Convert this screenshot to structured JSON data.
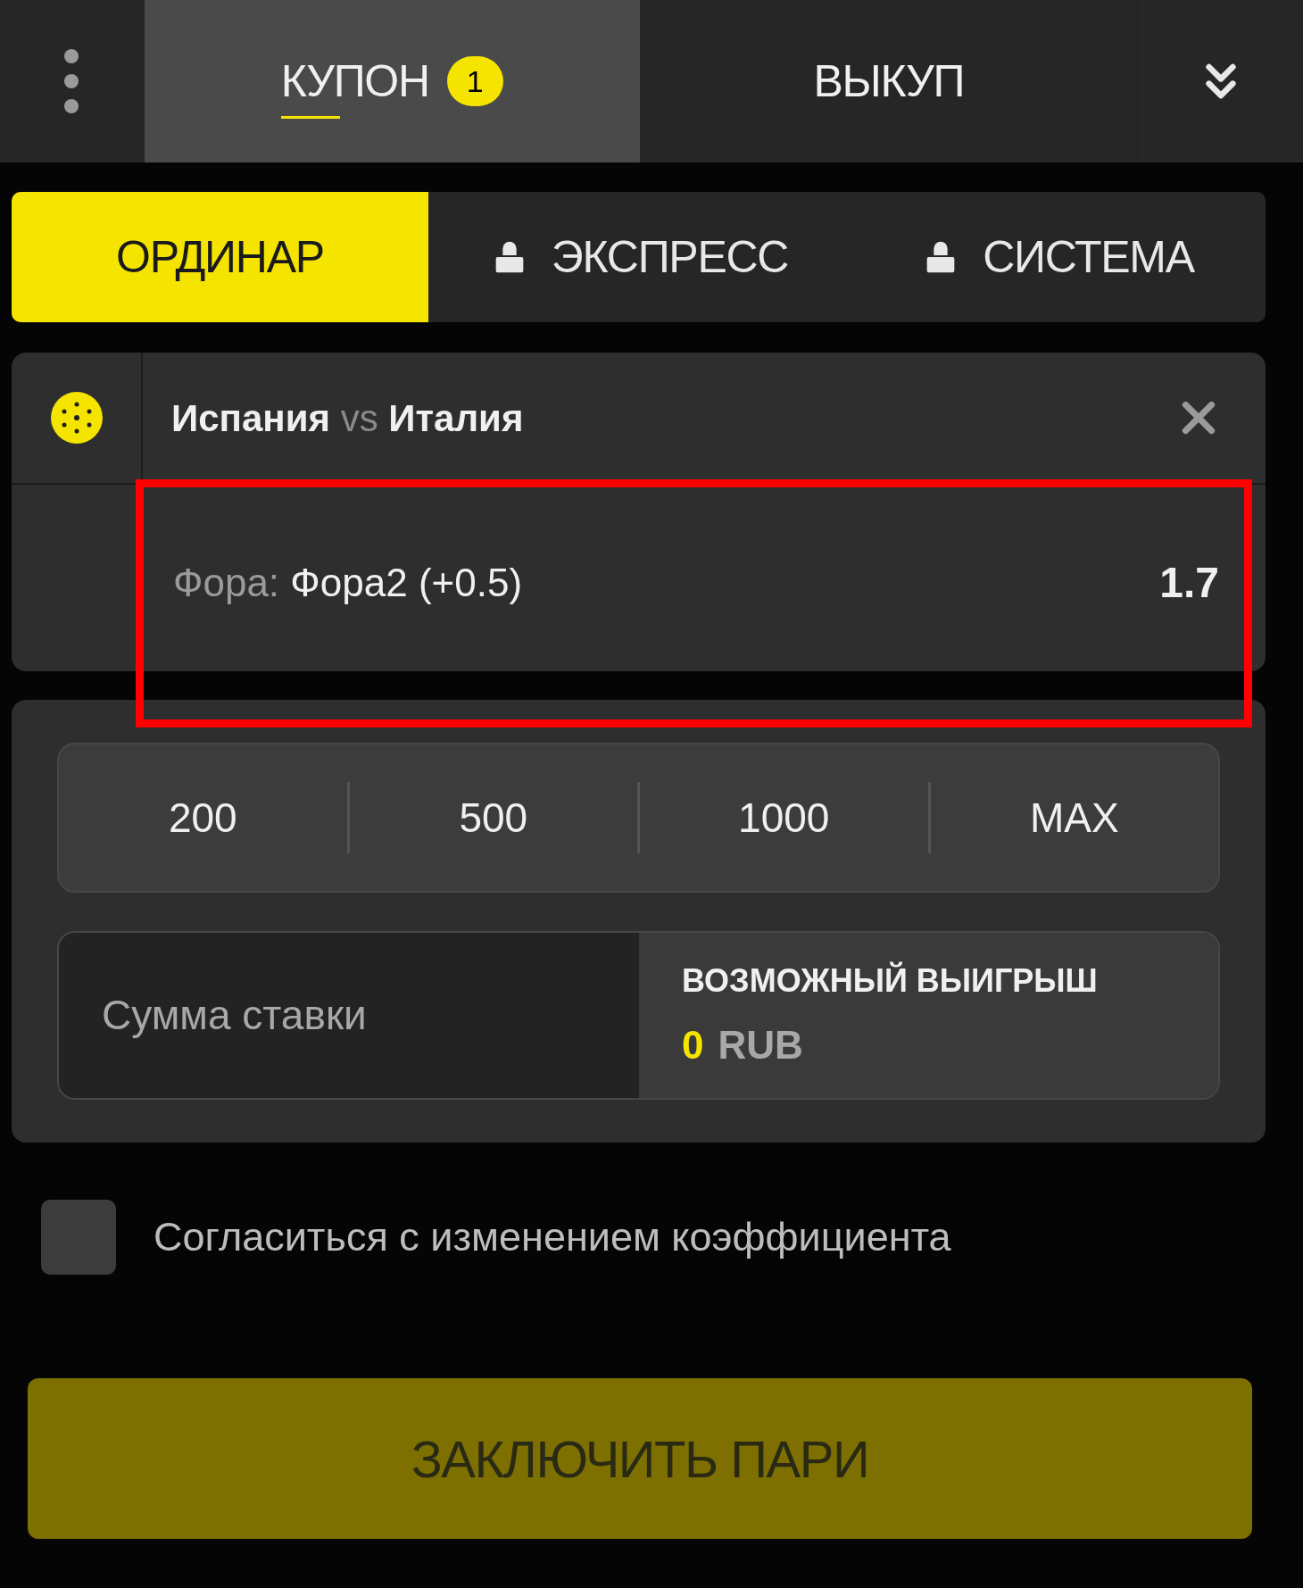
{
  "top_tabs": [
    {
      "label": "КУПОН",
      "badge": "1",
      "selected": true
    },
    {
      "label": "ВЫКУП",
      "selected": false
    }
  ],
  "bet_types": [
    {
      "label": "ОРДИНАР",
      "selected": true,
      "locked": false
    },
    {
      "label": "ЭКСПРЕСС",
      "selected": false,
      "locked": true
    },
    {
      "label": "СИСТЕМА",
      "selected": false,
      "locked": true
    }
  ],
  "event": {
    "home": "Испания",
    "separator": "vs",
    "away": "Италия"
  },
  "selection": {
    "market": "Фора:",
    "outcome": "Фора2 (+0.5)",
    "odds": "1.7",
    "highlighted": true
  },
  "quick_amounts": [
    "200",
    "500",
    "1000",
    "MAX"
  ],
  "stake": {
    "placeholder": "Сумма ставки"
  },
  "possible_win": {
    "label": "ВОЗМОЖНЫЙ ВЫИГРЫШ",
    "amount": "0",
    "currency": "RUB"
  },
  "accept_odds_change": {
    "label": "Согласиться с изменением коэффициента",
    "checked": false
  },
  "submit": {
    "label": "ЗАКЛЮЧИТЬ ПАРИ",
    "disabled": true
  }
}
